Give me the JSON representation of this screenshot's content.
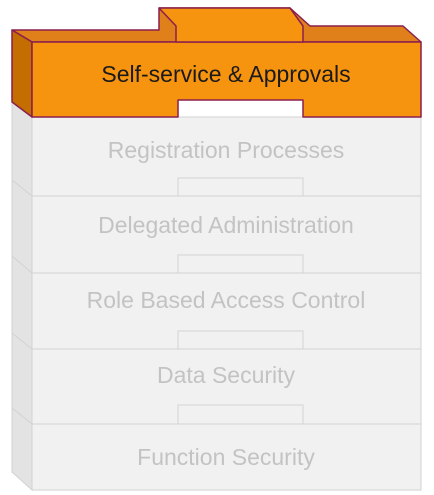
{
  "layers": [
    {
      "label": "Self-service & Approvals",
      "highlighted": true
    },
    {
      "label": "Registration Processes",
      "highlighted": false
    },
    {
      "label": "Delegated Administration",
      "highlighted": false
    },
    {
      "label": "Role Based Access Control",
      "highlighted": false
    },
    {
      "label": "Data Security",
      "highlighted": false
    },
    {
      "label": "Function Security",
      "highlighted": false
    }
  ],
  "colors": {
    "highlight_fill": "#f7940f",
    "highlight_edge": "#c46d00",
    "highlight_outline": "#8a1f4e",
    "highlight_text": "#1a1a1a",
    "muted_fill": "#f1f1f1",
    "muted_edge": "#e3e3e3",
    "muted_outline": "#d2d2d2",
    "muted_text": "#c3c3c3"
  }
}
